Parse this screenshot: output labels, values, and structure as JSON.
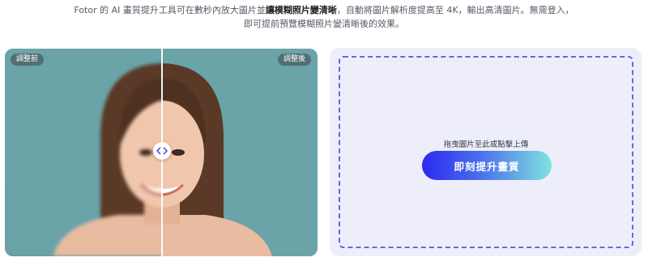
{
  "intro": {
    "line1_a": "Fotor 的 AI 畫質提升工具可在數秒內放大圖片並",
    "line1_strong": "讓模糊照片變清晰",
    "line1_b": "，自動將圖片解析度提高至 4K，輸出高清圖片。無需登入，",
    "line2": "即可提前預覽模糊照片變清晰後的效果。"
  },
  "compare": {
    "before_label": "調整前",
    "after_label": "調整後"
  },
  "upload": {
    "hint": "拖曳圖片至此或點擊上傳",
    "button_label": "即刻提升畫質"
  },
  "colors": {
    "dropzone_border": "#6c63e6",
    "card_bg": "#eeeefb",
    "button_gradient_start": "#2b2af0",
    "button_gradient_end": "#7fe3dc"
  },
  "icons": {
    "compare_handle": "left-right-arrows-icon"
  }
}
